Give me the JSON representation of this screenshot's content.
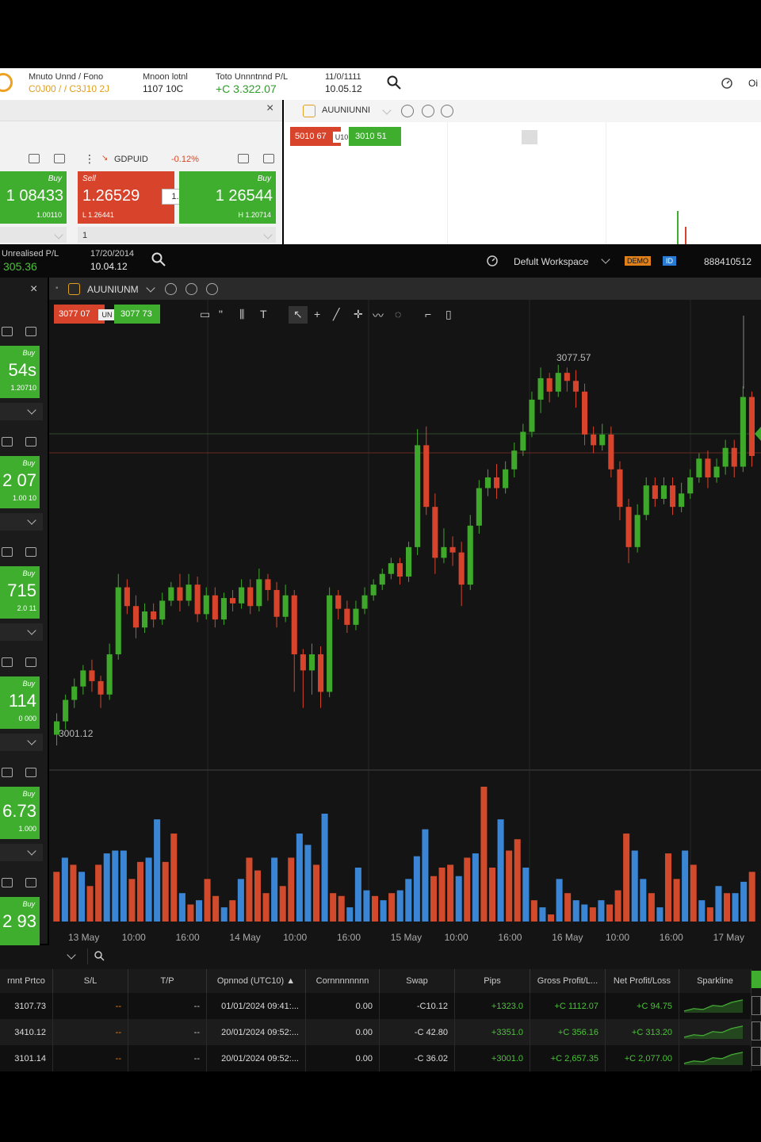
{
  "light": {
    "stats": [
      {
        "label": "Mnuto Unnd / Fono",
        "value": "C0J00 / / C3J10 2J"
      },
      {
        "label": "Mnoon lotnl",
        "value": "1107 10C"
      },
      {
        "label": "Toto Unnntnnd P/L",
        "value": "+C 3.322.07"
      },
      {
        "label": "11/0/1111",
        "value": "10.05.12"
      }
    ],
    "right_icon_label": "Oi",
    "instrument_left": "GDPUID",
    "change": "-0.12%",
    "tile_left_price": "1 08433",
    "tile_left_side": "Buy",
    "tile_left_sub": "1.00110",
    "sell_side": "Sell",
    "sell_price": "1.26529",
    "sell_sub": "L 1.26441",
    "spread": "1.5",
    "buy_side": "Buy",
    "buy_price": "1 26544",
    "buy_sub": "H 1.20714",
    "qty_left": "1",
    "instrument_right": "AUUNIUNNI",
    "sell_chip": "5010 67",
    "chip_mid": "U10",
    "buy_chip": "3010 51"
  },
  "dark": {
    "unrealised_label": "Unrealised P/L",
    "unrealised_value": "305.36",
    "date": "17/20/2014",
    "time": "10.04.12",
    "workspace": "Defult Workspace",
    "badge_orange": "DEMO",
    "badge_blue": "ID",
    "account": "888410512",
    "instrument": "AUUNIUNM",
    "sell_chip": "3077 07",
    "chip_mid": "UN",
    "buy_chip": "3077 73",
    "left_tiles": [
      {
        "price": "54s",
        "sub": "1.20710",
        "side": "Buy"
      },
      {
        "price": "2 07",
        "sub": "1.00 10",
        "side": "Buy"
      },
      {
        "price": "715",
        "sub": "2.0 11",
        "side": "Buy"
      },
      {
        "price": "114",
        "sub": "0 000",
        "side": "Buy"
      },
      {
        "price": "6.73",
        "sub": "1.000",
        "side": "Buy"
      },
      {
        "price": "2 93",
        "sub": "",
        "side": "Buy"
      }
    ]
  },
  "chart_data": {
    "type": "candlestick",
    "high_label": "3077.57",
    "low_label": "3001.12",
    "x_labels": [
      "13 May",
      "10:00",
      "16:00",
      "14 May",
      "10:00",
      "16:00",
      "15 May",
      "10:00",
      "16:00",
      "16 May",
      "10:00",
      "16:00",
      "17 May"
    ],
    "colors": {
      "up": "#3ea82a",
      "down": "#d8442b",
      "vol_blue": "#3a86d4",
      "vol_red": "#d14a2b"
    },
    "candles": [
      [
        3000,
        3005,
        2996,
        3008
      ],
      [
        3005,
        3013,
        3002,
        3015
      ],
      [
        3013,
        3018,
        3010,
        3021
      ],
      [
        3018,
        3024,
        3015,
        3026
      ],
      [
        3024,
        3020,
        3016,
        3028
      ],
      [
        3020,
        3015,
        3010,
        3022
      ],
      [
        3015,
        3030,
        3013,
        3034
      ],
      [
        3030,
        3055,
        3028,
        3060
      ],
      [
        3055,
        3048,
        3045,
        3058
      ],
      [
        3048,
        3040,
        3036,
        3052
      ],
      [
        3040,
        3046,
        3038,
        3049
      ],
      [
        3046,
        3043,
        3040,
        3049
      ],
      [
        3043,
        3050,
        3041,
        3053
      ],
      [
        3050,
        3055,
        3048,
        3057
      ],
      [
        3055,
        3050,
        3046,
        3060
      ],
      [
        3050,
        3056,
        3048,
        3060
      ],
      [
        3056,
        3045,
        3042,
        3059
      ],
      [
        3045,
        3052,
        3043,
        3055
      ],
      [
        3052,
        3043,
        3040,
        3055
      ],
      [
        3043,
        3051,
        3041,
        3053
      ],
      [
        3051,
        3049,
        3046,
        3054
      ],
      [
        3049,
        3055,
        3047,
        3058
      ],
      [
        3055,
        3048,
        3045,
        3058
      ],
      [
        3048,
        3058,
        3046,
        3062
      ],
      [
        3058,
        3054,
        3050,
        3060
      ],
      [
        3054,
        3044,
        3040,
        3057
      ],
      [
        3044,
        3052,
        3042,
        3056
      ],
      [
        3052,
        3030,
        3016,
        3054
      ],
      [
        3030,
        3024,
        3010,
        3032
      ],
      [
        3024,
        3030,
        3015,
        3034
      ],
      [
        3030,
        3016,
        3010,
        3033
      ],
      [
        3016,
        3052,
        3014,
        3055
      ],
      [
        3052,
        3047,
        3043,
        3054
      ],
      [
        3047,
        3041,
        3038,
        3050
      ],
      [
        3041,
        3047,
        3039,
        3050
      ],
      [
        3047,
        3052,
        3045,
        3055
      ],
      [
        3052,
        3056,
        3050,
        3058
      ],
      [
        3056,
        3060,
        3054,
        3062
      ],
      [
        3060,
        3064,
        3058,
        3066
      ],
      [
        3064,
        3059,
        3056,
        3066
      ],
      [
        3059,
        3070,
        3057,
        3072
      ],
      [
        3070,
        3108,
        3067,
        3114
      ],
      [
        3108,
        3085,
        3082,
        3115
      ],
      [
        3085,
        3066,
        3060,
        3090
      ],
      [
        3066,
        3070,
        3064,
        3077
      ],
      [
        3070,
        3068,
        3063,
        3074
      ],
      [
        3068,
        3056,
        3048,
        3072
      ],
      [
        3056,
        3078,
        3054,
        3082
      ],
      [
        3078,
        3092,
        3075,
        3095
      ],
      [
        3092,
        3096,
        3089,
        3099
      ],
      [
        3096,
        3092,
        3088,
        3101
      ],
      [
        3092,
        3099,
        3090,
        3102
      ],
      [
        3099,
        3106,
        3096,
        3109
      ],
      [
        3106,
        3113,
        3104,
        3116
      ],
      [
        3113,
        3125,
        3111,
        3128
      ],
      [
        3125,
        3133,
        3120,
        3137
      ],
      [
        3133,
        3128,
        3124,
        3135
      ],
      [
        3128,
        3135,
        3126,
        3138
      ],
      [
        3135,
        3132,
        3128,
        3137
      ],
      [
        3132,
        3128,
        3122,
        3136
      ],
      [
        3128,
        3112,
        3108,
        3131
      ],
      [
        3112,
        3108,
        3105,
        3115
      ],
      [
        3108,
        3112,
        3106,
        3116
      ],
      [
        3112,
        3099,
        3096,
        3115
      ],
      [
        3099,
        3085,
        3080,
        3102
      ],
      [
        3085,
        3070,
        3064,
        3088
      ],
      [
        3070,
        3082,
        3068,
        3086
      ],
      [
        3082,
        3093,
        3080,
        3096
      ],
      [
        3093,
        3088,
        3085,
        3096
      ],
      [
        3088,
        3093,
        3086,
        3096
      ],
      [
        3093,
        3085,
        3082,
        3096
      ],
      [
        3085,
        3090,
        3083,
        3094
      ],
      [
        3090,
        3096,
        3088,
        3099
      ],
      [
        3096,
        3103,
        3094,
        3105
      ],
      [
        3103,
        3096,
        3092,
        3106
      ],
      [
        3096,
        3100,
        3094,
        3103
      ],
      [
        3100,
        3107,
        3097,
        3110
      ],
      [
        3107,
        3100,
        3096,
        3110
      ],
      [
        3100,
        3126,
        3098,
        3130
      ],
      [
        3126,
        3104,
        3100,
        3128
      ]
    ],
    "volumes": [
      [
        35,
        "r"
      ],
      [
        45,
        "b"
      ],
      [
        40,
        "r"
      ],
      [
        35,
        "b"
      ],
      [
        25,
        "r"
      ],
      [
        40,
        "r"
      ],
      [
        48,
        "b"
      ],
      [
        50,
        "b"
      ],
      [
        50,
        "b"
      ],
      [
        30,
        "r"
      ],
      [
        42,
        "r"
      ],
      [
        45,
        "b"
      ],
      [
        72,
        "b"
      ],
      [
        42,
        "r"
      ],
      [
        62,
        "r"
      ],
      [
        20,
        "b"
      ],
      [
        12,
        "r"
      ],
      [
        15,
        "b"
      ],
      [
        30,
        "r"
      ],
      [
        18,
        "r"
      ],
      [
        10,
        "b"
      ],
      [
        15,
        "r"
      ],
      [
        30,
        "b"
      ],
      [
        45,
        "r"
      ],
      [
        36,
        "r"
      ],
      [
        20,
        "r"
      ],
      [
        45,
        "b"
      ],
      [
        25,
        "r"
      ],
      [
        45,
        "r"
      ],
      [
        62,
        "b"
      ],
      [
        54,
        "b"
      ],
      [
        40,
        "r"
      ],
      [
        76,
        "b"
      ],
      [
        20,
        "r"
      ],
      [
        18,
        "r"
      ],
      [
        10,
        "b"
      ],
      [
        38,
        "b"
      ],
      [
        22,
        "b"
      ],
      [
        18,
        "r"
      ],
      [
        15,
        "b"
      ],
      [
        20,
        "r"
      ],
      [
        22,
        "b"
      ],
      [
        30,
        "b"
      ],
      [
        46,
        "b"
      ],
      [
        65,
        "b"
      ],
      [
        32,
        "r"
      ],
      [
        38,
        "r"
      ],
      [
        40,
        "r"
      ],
      [
        32,
        "b"
      ],
      [
        45,
        "r"
      ],
      [
        48,
        "b"
      ],
      [
        95,
        "r"
      ],
      [
        38,
        "r"
      ],
      [
        72,
        "b"
      ],
      [
        50,
        "r"
      ],
      [
        58,
        "r"
      ],
      [
        38,
        "b"
      ],
      [
        15,
        "r"
      ],
      [
        10,
        "b"
      ],
      [
        5,
        "r"
      ],
      [
        30,
        "b"
      ],
      [
        20,
        "r"
      ],
      [
        15,
        "b"
      ],
      [
        12,
        "b"
      ],
      [
        10,
        "r"
      ],
      [
        15,
        "b"
      ],
      [
        12,
        "r"
      ],
      [
        22,
        "r"
      ],
      [
        62,
        "r"
      ],
      [
        50,
        "b"
      ],
      [
        30,
        "b"
      ],
      [
        20,
        "r"
      ],
      [
        10,
        "b"
      ],
      [
        48,
        "r"
      ],
      [
        30,
        "r"
      ],
      [
        50,
        "b"
      ],
      [
        40,
        "r"
      ],
      [
        15,
        "b"
      ],
      [
        10,
        "r"
      ],
      [
        25,
        "b"
      ],
      [
        20,
        "r"
      ],
      [
        20,
        "b"
      ],
      [
        28,
        "b"
      ],
      [
        35,
        "r"
      ]
    ]
  },
  "table": {
    "columns": [
      "rnnt Prtco",
      "S/L",
      "T/P",
      "Opnnod (UTC10) ▲",
      "Cornnnnnnnn",
      "Swap",
      "Pips",
      "Gross Profit/L...",
      "Net Profit/Loss",
      "Sparkline"
    ],
    "search_placeholder": "",
    "rows": [
      {
        "price": "3107.73",
        "sl": "--",
        "tp": "--",
        "opened": "01/01/2024 09:41:...",
        "commission": "0.00",
        "swap": "-C10.12",
        "pips": "+1323.0",
        "gross": "+C 1112.07",
        "net": "+C 94.75"
      },
      {
        "price": "3410.12",
        "sl": "--",
        "tp": "--",
        "opened": "20/01/2024 09:52:...",
        "commission": "0.00",
        "swap": "-C 42.80",
        "pips": "+3351.0",
        "gross": "+C 356.16",
        "net": "+C 313.20"
      },
      {
        "price": "3101.14",
        "sl": "--",
        "tp": "--",
        "opened": "20/01/2024 09:52:...",
        "commission": "0.00",
        "swap": "-C 36.02",
        "pips": "+3001.0",
        "gross": "+C 2,657.35",
        "net": "+C 2,077.00"
      }
    ]
  }
}
